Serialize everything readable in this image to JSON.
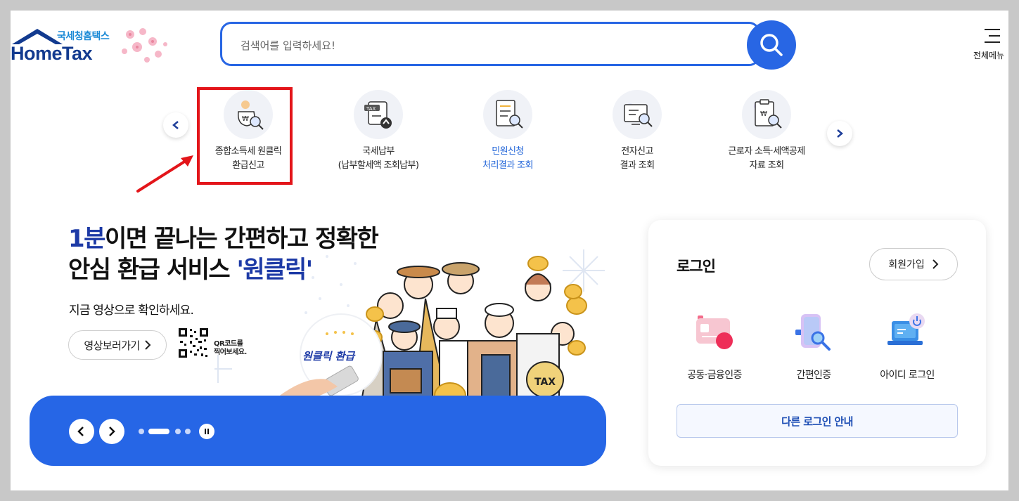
{
  "header": {
    "logo_korean": "국세청홈택스",
    "logo_english": "HomeTax",
    "search_placeholder": "검색어를 입력하세요!",
    "menu_label": "전체메뉴"
  },
  "quick_menu": {
    "items": [
      {
        "label": "종합소득세 원클릭\n환급신고",
        "icon": "money-bag-search-icon"
      },
      {
        "label": "국세납부\n(납부할세액 조회납부)",
        "icon": "tax-payment-icon"
      },
      {
        "label": "민원신청\n처리결과 조회",
        "icon": "document-search-icon"
      },
      {
        "label": "전자신고\n결과 조회",
        "icon": "monitor-search-icon"
      },
      {
        "label": "근로자 소득·세액공제\n자료 조회",
        "icon": "clipboard-search-icon"
      }
    ]
  },
  "banner": {
    "headline_blue": "1분",
    "headline_line1_rest": "이면 끝나는 간편하고 정확한",
    "headline_line2_start": "안심 환급 서비스 ",
    "headline_line2_blue": "'원클릭'",
    "subtitle": "지금 영상으로 확인하세요.",
    "video_button": "영상보러가기",
    "qr_text": "QR코드를\n찍어보세요.",
    "badge_text": "원클릭 환급",
    "tax_bag_text": "TAX",
    "slides_count": 4,
    "active_slide": 2
  },
  "login": {
    "title": "로그인",
    "join_button": "회원가입",
    "options": [
      "공동·금융인증",
      "간편인증",
      "아이디 로그인"
    ],
    "other_button": "다른 로그인 안내"
  },
  "colors": {
    "primary": "#2666e6",
    "navy": "#1d3aa6",
    "highlight": "#e3151a"
  }
}
